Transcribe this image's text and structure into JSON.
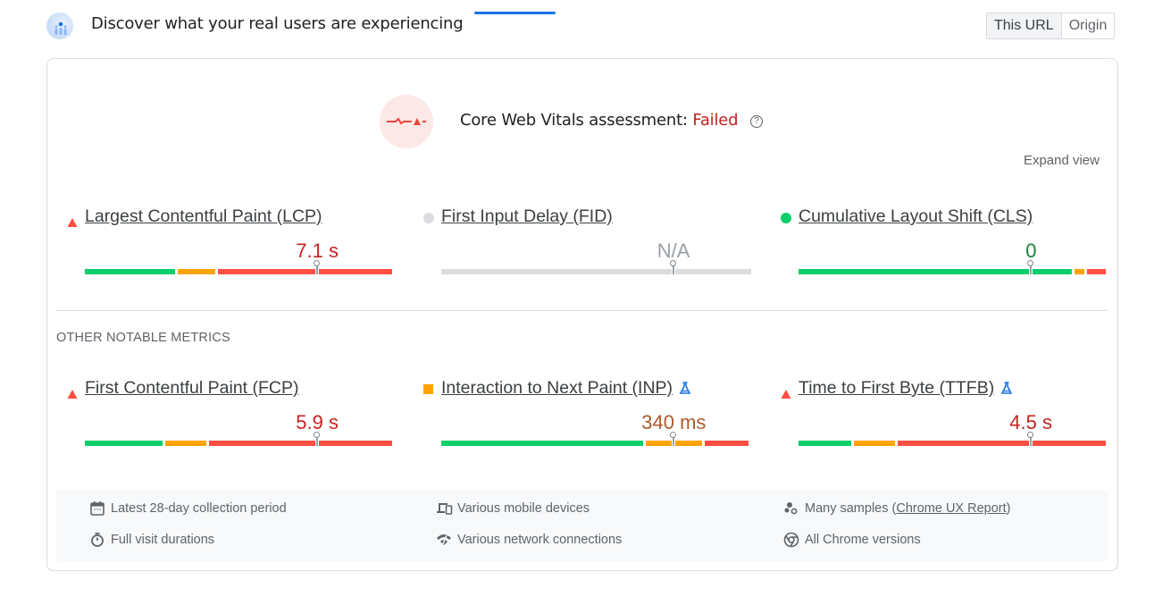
{
  "header": {
    "title": "Discover what your real users are experiencing",
    "logo_icon": "crux-users-icon",
    "toggle": {
      "options": [
        "This URL",
        "Origin"
      ],
      "selected": "This URL"
    }
  },
  "assessment": {
    "label": "Core Web Vitals assessment:",
    "status": "Failed",
    "icon": "failed-pulse-icon",
    "help_icon": "help-icon",
    "help_glyph": "?"
  },
  "expand_view_label": "Expand view",
  "colors": {
    "good": "#0cce6b",
    "needs_improvement": "#ffa400",
    "poor": "#ff4e42",
    "na": "#dadce0",
    "poor_text": "#c5221f",
    "ni_text": "#b05a2a",
    "good_text": "#188038",
    "na_text": "#9aa0a6",
    "accent": "#1a73e8"
  },
  "core_metrics": [
    {
      "name": "Largest Contentful Paint (LCP)",
      "value": "7.1 s",
      "rating": "poor",
      "indicator": "triangle",
      "experimental": false,
      "distribution": {
        "good": 0.3,
        "needs_improvement": 0.13,
        "poor": 0.57
      },
      "p75_position": 0.75
    },
    {
      "name": "First Input Delay (FID)",
      "value": "N/A",
      "rating": "na",
      "indicator": "circle",
      "experimental": false,
      "distribution": {
        "good": 0,
        "needs_improvement": 0,
        "poor": 0
      },
      "p75_position": 0.75
    },
    {
      "name": "Cumulative Layout Shift (CLS)",
      "value": "0",
      "rating": "good",
      "indicator": "circle",
      "experimental": false,
      "distribution": {
        "good": 0.89,
        "needs_improvement": 0.04,
        "poor": 0.07
      },
      "p75_position": 0.75
    }
  ],
  "other_section_label": "OTHER NOTABLE METRICS",
  "other_metrics": [
    {
      "name": "First Contentful Paint (FCP)",
      "value": "5.9 s",
      "rating": "poor",
      "indicator": "triangle",
      "experimental": false,
      "distribution": {
        "good": 0.26,
        "needs_improvement": 0.14,
        "poor": 0.6
      },
      "p75_position": 0.75
    },
    {
      "name": "Interaction to Next Paint (INP)",
      "value": "340 ms",
      "rating": "needs_improvement",
      "indicator": "square",
      "experimental": true,
      "distribution": {
        "good": 0.66,
        "needs_improvement": 0.19,
        "poor": 0.15
      },
      "p75_position": 0.75
    },
    {
      "name": "Time to First Byte (TTFB)",
      "value": "4.5 s",
      "rating": "poor",
      "indicator": "triangle",
      "experimental": true,
      "distribution": {
        "good": 0.18,
        "needs_improvement": 0.14,
        "poor": 0.68
      },
      "p75_position": 0.75
    }
  ],
  "footer": {
    "items": [
      {
        "icon": "calendar-icon",
        "text": "Latest 28-day collection period"
      },
      {
        "icon": "stopwatch-icon",
        "text": "Full visit durations"
      },
      {
        "icon": "devices-icon",
        "text": "Various mobile devices"
      },
      {
        "icon": "network-icon",
        "text": "Various network connections"
      },
      {
        "icon": "samples-icon",
        "text": "Many samples (",
        "link": "Chrome UX Report",
        "suffix": ")"
      },
      {
        "icon": "chrome-icon",
        "text": "All Chrome versions"
      }
    ]
  }
}
